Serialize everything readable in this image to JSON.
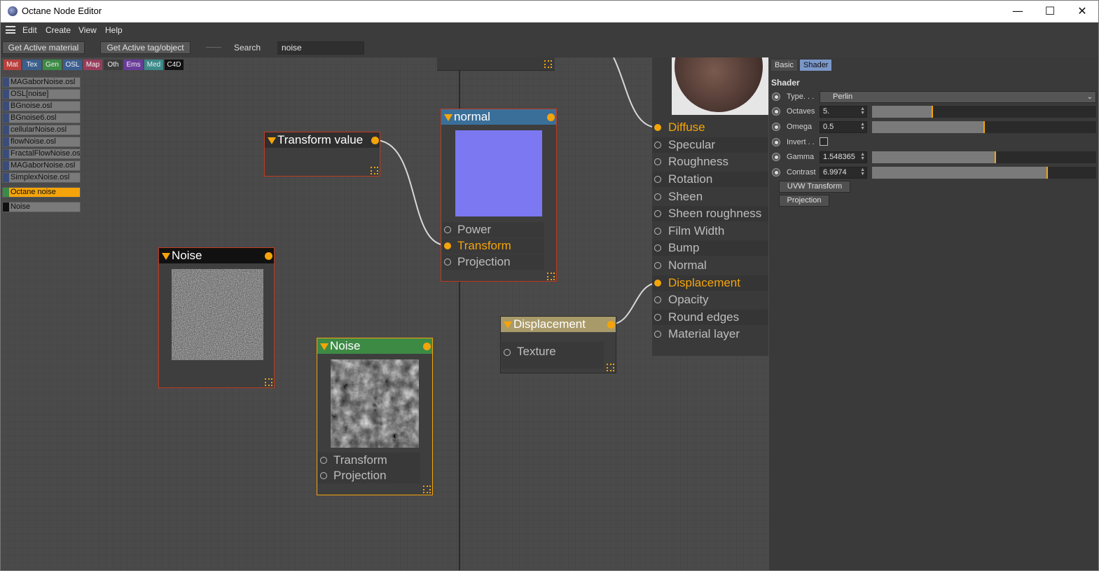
{
  "window": {
    "title": "Octane Node Editor",
    "minimize": "—",
    "maximize": "☐",
    "close": "✕"
  },
  "menu": [
    "Edit",
    "Create",
    "View",
    "Help"
  ],
  "toolbar": {
    "get_material": "Get Active material",
    "get_tag": "Get Active tag/object",
    "search_label": "Search",
    "search_value": "noise"
  },
  "categories": [
    {
      "label": "Mat",
      "color": "#b8403c"
    },
    {
      "label": "Tex",
      "color": "#3b5f8c"
    },
    {
      "label": "Gen",
      "color": "#3d8a45"
    },
    {
      "label": "OSL",
      "color": "#3c5f92"
    },
    {
      "label": "Map",
      "color": "#9a3c5c"
    },
    {
      "label": "Oth",
      "color": "#3c3c3c"
    },
    {
      "label": "Ems",
      "color": "#6a3c9a"
    },
    {
      "label": "Med",
      "color": "#3c8a8a"
    },
    {
      "label": "C4D",
      "color": "#111111"
    }
  ],
  "node_list": [
    "MAGaborNoise.osl",
    "OSL[noise]",
    "BGnoise.osl",
    "BGnoise6.osl",
    "cellularNoise.osl",
    "flowNoise.osl",
    "FractalFlowNoise.osl",
    "MAGaborNoise.osl",
    "SimplexNoise.osl",
    "Octane noise",
    "Noise"
  ],
  "nodes": {
    "transform_value": {
      "title": "Transform value"
    },
    "normal": {
      "title": "normal",
      "pins": [
        "Power",
        "Transform",
        "Projection"
      ]
    },
    "noise_c4d": {
      "title": "Noise"
    },
    "noise_octane": {
      "title": "Noise",
      "pins": [
        "Transform",
        "Projection"
      ]
    },
    "displacement": {
      "title": "Displacement",
      "pins": [
        "Texture"
      ]
    },
    "material": {
      "pins": [
        "Diffuse",
        "Specular",
        "Roughness",
        "Rotation",
        "Sheen",
        "Sheen roughness",
        "Film Width",
        "Bump",
        "Normal",
        "Displacement",
        "Opacity",
        "Round edges",
        "Material layer"
      ]
    }
  },
  "panel": {
    "tabs": [
      "Basic",
      "Shader"
    ],
    "section": "Shader",
    "type_label": "Type. . .",
    "type_value": "Perlin",
    "params": [
      {
        "label": "Octaves",
        "value": "5.",
        "fraction": 0.27
      },
      {
        "label": "Omega",
        "value": "0.5",
        "fraction": 0.5
      },
      {
        "label": "Gamma",
        "value": "1.548365",
        "fraction": 0.55
      },
      {
        "label": "Contrast",
        "value": "6.9974",
        "fraction": 0.78
      }
    ],
    "invert_label": "Invert . .",
    "buttons": [
      "UVW Transform",
      "Projection"
    ]
  },
  "colors": {
    "accent": "#f4a40a",
    "node_border": "#c0391f"
  }
}
